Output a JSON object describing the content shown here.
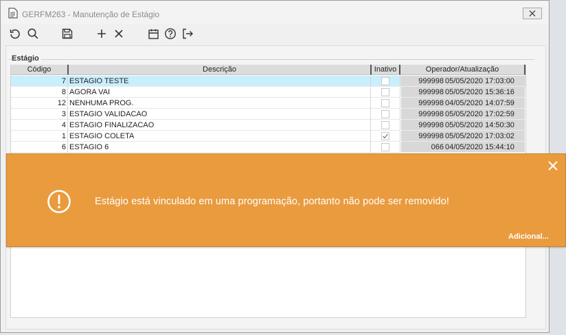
{
  "window": {
    "title": "GERFM263 - Manutenção de Estágio"
  },
  "toolbar": {
    "buttons": [
      {
        "icon": "refresh-icon"
      },
      {
        "icon": "search-icon"
      },
      {
        "icon": "save-icon"
      },
      {
        "icon": "add-icon"
      },
      {
        "icon": "delete-icon"
      },
      {
        "icon": "calendar-icon"
      },
      {
        "icon": "help-icon"
      },
      {
        "icon": "exit-icon"
      }
    ]
  },
  "group": {
    "title": "Estágio"
  },
  "grid": {
    "headers": {
      "code": "Código",
      "description": "Descrição",
      "inactive": "Inativo",
      "operator": "Operador/Atualização"
    },
    "rows": [
      {
        "code": "7",
        "description": "ESTAGIO TESTE",
        "inactive": false,
        "operator": "999998",
        "updated": "05/05/2020 17:03:00",
        "selected": true
      },
      {
        "code": "8",
        "description": "AGORA VAI",
        "inactive": false,
        "operator": "999998",
        "updated": "05/05/2020 15:36:16",
        "selected": false
      },
      {
        "code": "12",
        "description": "NENHUMA PROG.",
        "inactive": false,
        "operator": "999998",
        "updated": "04/05/2020 14:07:59",
        "selected": false
      },
      {
        "code": "3",
        "description": "ESTAGIO VALIDACAO",
        "inactive": false,
        "operator": "999998",
        "updated": "05/05/2020 17:02:59",
        "selected": false
      },
      {
        "code": "4",
        "description": "ESTAGIO FINALIZACAO",
        "inactive": false,
        "operator": "999998",
        "updated": "05/05/2020 14:50:30",
        "selected": false
      },
      {
        "code": "1",
        "description": "ESTAGIO COLETA",
        "inactive": true,
        "operator": "999998",
        "updated": "05/05/2020 17:03:02",
        "selected": false
      },
      {
        "code": "6",
        "description": "ESTAGIO 6",
        "inactive": false,
        "operator": "066",
        "updated": "04/05/2020 15:44:10",
        "selected": false
      }
    ]
  },
  "toast": {
    "message": "Estágio está vinculado em uma programação, portanto não pode ser removido!",
    "more_link": "Adicional...",
    "color": "#e99b3e"
  }
}
